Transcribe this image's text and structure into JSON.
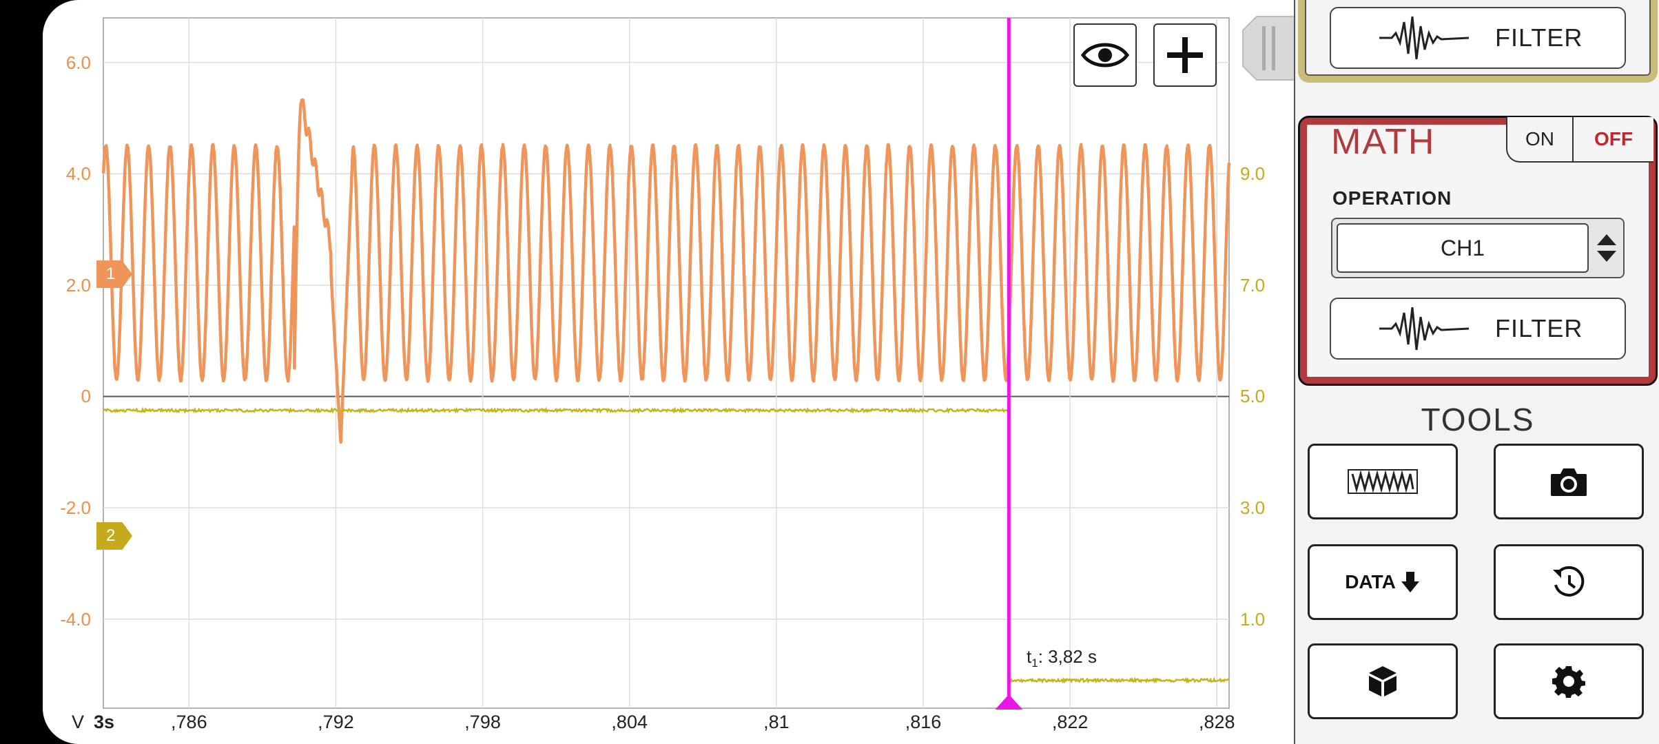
{
  "chart_data": {
    "type": "line",
    "left_axis": {
      "ticks": [
        "6.0",
        "4.0",
        "2.0",
        "0",
        "-2.0",
        "-4.0"
      ],
      "values": [
        6,
        4,
        2,
        0,
        -2,
        -4
      ],
      "unit": "V",
      "color": "#e8914a"
    },
    "right_axis": {
      "ticks": [
        "9.0",
        "7.0",
        "5.0",
        "3.0",
        "1.0"
      ],
      "values": [
        9,
        7,
        5,
        3,
        1
      ],
      "color": "#c6a91c"
    },
    "x_axis": {
      "first_label": "3s",
      "ticks": [
        ",786",
        ",792",
        ",798",
        ",804",
        ",81",
        ",816",
        ",822",
        ",828"
      ],
      "values": [
        3.786,
        3.792,
        3.798,
        3.804,
        3.81,
        3.816,
        3.822,
        3.828
      ]
    },
    "xlim": [
      3.7825,
      3.8285
    ],
    "ylim": [
      -5.6,
      6.8
    ],
    "grid": true,
    "series": [
      {
        "channel": "1",
        "color": "#f0955a",
        "waveform": "oscillation",
        "peak_v": 4.5,
        "trough_v": 0.3,
        "period_s": 0.000875,
        "glitch_at_s": 3.791,
        "glitch_peak_v": 5.3,
        "dropout_min_v": -0.85
      },
      {
        "channel": "2",
        "color": "#c6b41c",
        "level_before_cursor_v": -0.25,
        "level_after_cursor_v": -5.1
      }
    ],
    "cursor": {
      "label": "t",
      "sub": "1",
      "value_text": ": 3,82 s",
      "time_s": 3.8195,
      "color": "#e817e8"
    }
  },
  "units_label": "V",
  "channel_markers": [
    {
      "label": "1",
      "color": "#f0955a",
      "level_v": 2.2
    },
    {
      "label": "2",
      "color": "#c6a91c",
      "level_v": -2.6
    }
  ],
  "plot_buttons": {
    "visibility": "eye-icon",
    "add": "plus-icon"
  },
  "panel": {
    "filter1_label": "FILTER",
    "math": {
      "title": "MATH",
      "on_label": "ON",
      "off_label": "OFF",
      "operation_label": "OPERATION",
      "operation_value": "CH1",
      "filter_label": "FILTER",
      "color": "#b03a3e"
    },
    "tools": {
      "title": "TOOLS",
      "data_label": "DATA"
    }
  }
}
